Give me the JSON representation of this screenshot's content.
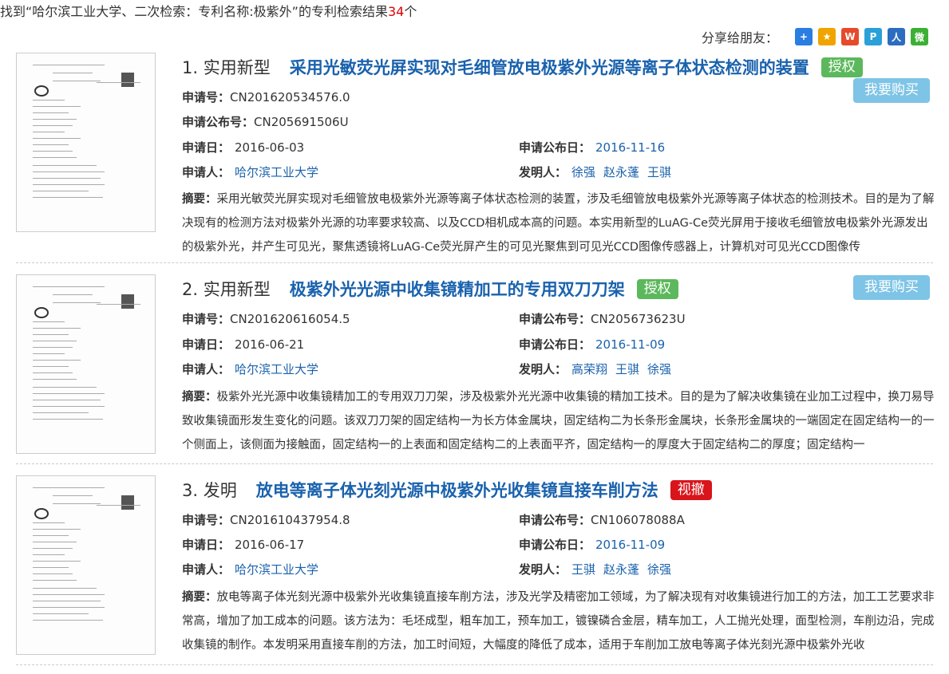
{
  "header": {
    "prefix": "找到“哈尔滨工业大学、二次检索：专利名称:极紫外”的专利检索结果",
    "count": "34",
    "suffix": "个"
  },
  "share": {
    "label": "分享给朋友：",
    "icons": [
      {
        "name": "plus-share-icon",
        "color": "#2a7de1",
        "glyph": "+"
      },
      {
        "name": "qzone-share-icon",
        "color": "#f0a400",
        "glyph": "★"
      },
      {
        "name": "weibo-share-icon",
        "color": "#e64a2b",
        "glyph": "W"
      },
      {
        "name": "tencent-weibo-share-icon",
        "color": "#2aa0d8",
        "glyph": "P"
      },
      {
        "name": "renren-share-icon",
        "color": "#2d6dc0",
        "glyph": "人"
      },
      {
        "name": "wechat-share-icon",
        "color": "#3cb034",
        "glyph": "微"
      }
    ]
  },
  "labels": {
    "app_no": "申请号：",
    "pub_no": "申请公布号：",
    "app_date": "申请日：",
    "pub_date": "申请公布日：",
    "applicant": "申请人：",
    "inventor": "发明人：",
    "abstract": "摘要：",
    "buy": "我要购买"
  },
  "records": [
    {
      "no": "1. 实用新型",
      "title": "采用光敏荧光屏实现对毛细管放电极紫外光源等离子体状态检测的装置",
      "status": "授权",
      "app_no": "CN201620534576.0",
      "pub_no": "CN205691506U",
      "app_date": "2016-06-03",
      "pub_date": "2016-11-16",
      "applicant": "哈尔滨工业大学",
      "inventors": [
        "徐强",
        "赵永蓬",
        "王骐"
      ],
      "abstract": "采用光敏荧光屏实现对毛细管放电极紫外光源等离子体状态检测的装置，涉及毛细管放电极紫外光源等离子体状态的检测技术。目的是为了解决现有的检测方法对极紫外光源的功率要求较高、以及CCD相机成本高的问题。本实用新型的LuAG-Ce荧光屏用于接收毛细管放电极紫外光源发出的极紫外光，并产生可见光，聚焦透镜将LuAG-Ce荧光屏产生的可见光聚焦到可见光CCD图像传感器上，计算机对可见光CCD图像传"
    },
    {
      "no": "2. 实用新型",
      "title": "极紫外光光源中收集镜精加工的专用双刀刀架",
      "status": "授权",
      "app_no": "CN201620616054.5",
      "pub_no": "CN205673623U",
      "app_date": "2016-06-21",
      "pub_date": "2016-11-09",
      "applicant": "哈尔滨工业大学",
      "inventors": [
        "高荣翔",
        "王骐",
        "徐强"
      ],
      "abstract": "极紫外光光源中收集镜精加工的专用双刀刀架，涉及极紫外光光源中收集镜的精加工技术。目的是为了解决收集镜在业加工过程中，换刀易导致收集镜面形发生变化的问题。该双刀刀架的固定结构一为长方体金属块，固定结构二为长条形金属块，长条形金属块的一端固定在固定结构一的一个侧面上，该侧面为接触面，固定结构一的上表面和固定结构二的上表面平齐，固定结构一的厚度大于固定结构二的厚度；固定结构一"
    },
    {
      "no": "3. 发明",
      "title": "放电等离子体光刻光源中极紫外光收集镜直接车削方法",
      "status": "视撤",
      "app_no": "CN201610437954.8",
      "pub_no": "CN106078088A",
      "app_date": "2016-06-17",
      "pub_date": "2016-11-09",
      "applicant": "哈尔滨工业大学",
      "inventors": [
        "王骐",
        "赵永蓬",
        "徐强"
      ],
      "abstract": "放电等离子体光刻光源中极紫外光收集镜直接车削方法，涉及光学及精密加工领域，为了解决现有对收集镜进行加工的方法，加工工艺要求非常高，增加了加工成本的问题。该方法为：毛坯成型，粗车加工，预车加工，镀镍磷合金层，精车加工，人工抛光处理，面型检测，车削边沿，完成收集镜的制作。本发明采用直接车削的方法，加工时间短，大幅度的降低了成本，适用于车削加工放电等离子体光刻光源中极紫外光收"
    }
  ]
}
